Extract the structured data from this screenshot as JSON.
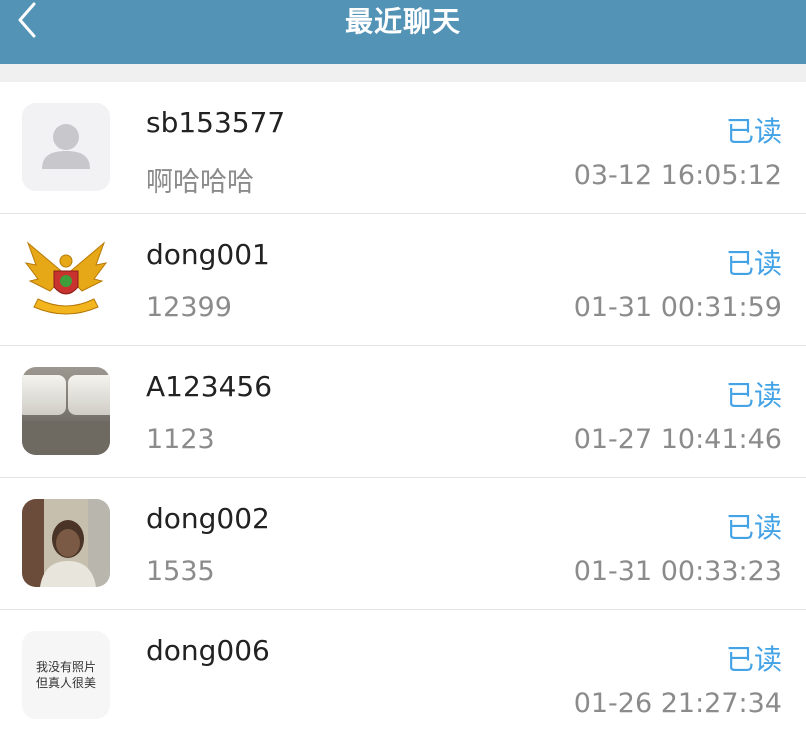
{
  "header": {
    "title": "最近聊天",
    "back_icon": "chevron-left-icon",
    "color": "#5393b6"
  },
  "chats": [
    {
      "name": "sb153577",
      "preview": "啊哈哈哈",
      "status": "已读",
      "time": "03-12 16:05:12",
      "avatar": "default-user-icon"
    },
    {
      "name": "dong001",
      "preview": "12399",
      "status": "已读",
      "time": "01-31 00:31:59",
      "avatar": "eagle-emblem-image"
    },
    {
      "name": "A123456",
      "preview": "1123",
      "status": "已读",
      "time": "01-27 10:41:46",
      "avatar": "keyboard-photo"
    },
    {
      "name": "dong002",
      "preview": "1535",
      "status": "已读",
      "time": "01-31 00:33:23",
      "avatar": "person-photo"
    },
    {
      "name": "dong006",
      "preview": "",
      "status": "已读",
      "time": "01-26 21:27:34",
      "avatar": "text-image",
      "avatar_text": [
        "我没有照片",
        "但真人很美"
      ]
    }
  ],
  "colors": {
    "read_status": "#43a3e6",
    "secondary_text": "#8b8b8b"
  }
}
